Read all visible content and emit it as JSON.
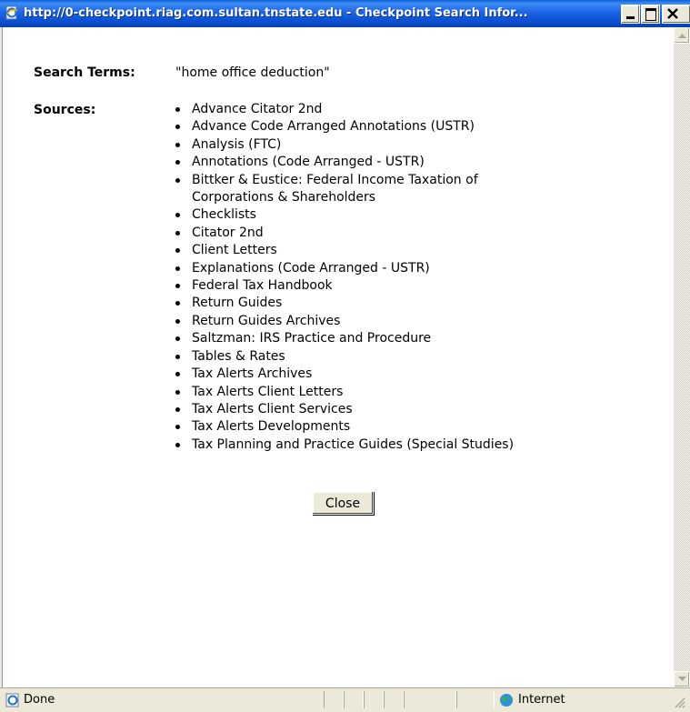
{
  "window": {
    "title": "http://0-checkpoint.riag.com.sultan.tnstate.edu - Checkpoint Search Infor...",
    "icon": "ie-page-icon"
  },
  "search": {
    "terms_label": "Search Terms:",
    "terms_value": "\"home office deduction\""
  },
  "sources": {
    "label": "Sources:",
    "items": [
      "Advance Citator 2nd",
      "Advance Code Arranged Annotations (USTR)",
      "Analysis (FTC)",
      "Annotations (Code Arranged - USTR)",
      "Bittker & Eustice: Federal Income Taxation of Corporations & Shareholders",
      "Checklists",
      "Citator 2nd",
      "Client Letters",
      "Explanations (Code Arranged - USTR)",
      "Federal Tax Handbook",
      "Return Guides",
      "Return Guides Archives",
      "Saltzman: IRS Practice and Procedure",
      "Tables & Rates",
      "Tax Alerts Archives",
      "Tax Alerts Client Letters",
      "Tax Alerts Client Services",
      "Tax Alerts Developments",
      "Tax Planning and Practice Guides (Special Studies)"
    ]
  },
  "buttons": {
    "close_label": "Close"
  },
  "statusbar": {
    "status_text": "Done",
    "zone_text": "Internet"
  },
  "colors": {
    "titlebar": "#0a4fd0",
    "window_bg": "#ece9d8",
    "content_bg": "#ffffff"
  }
}
